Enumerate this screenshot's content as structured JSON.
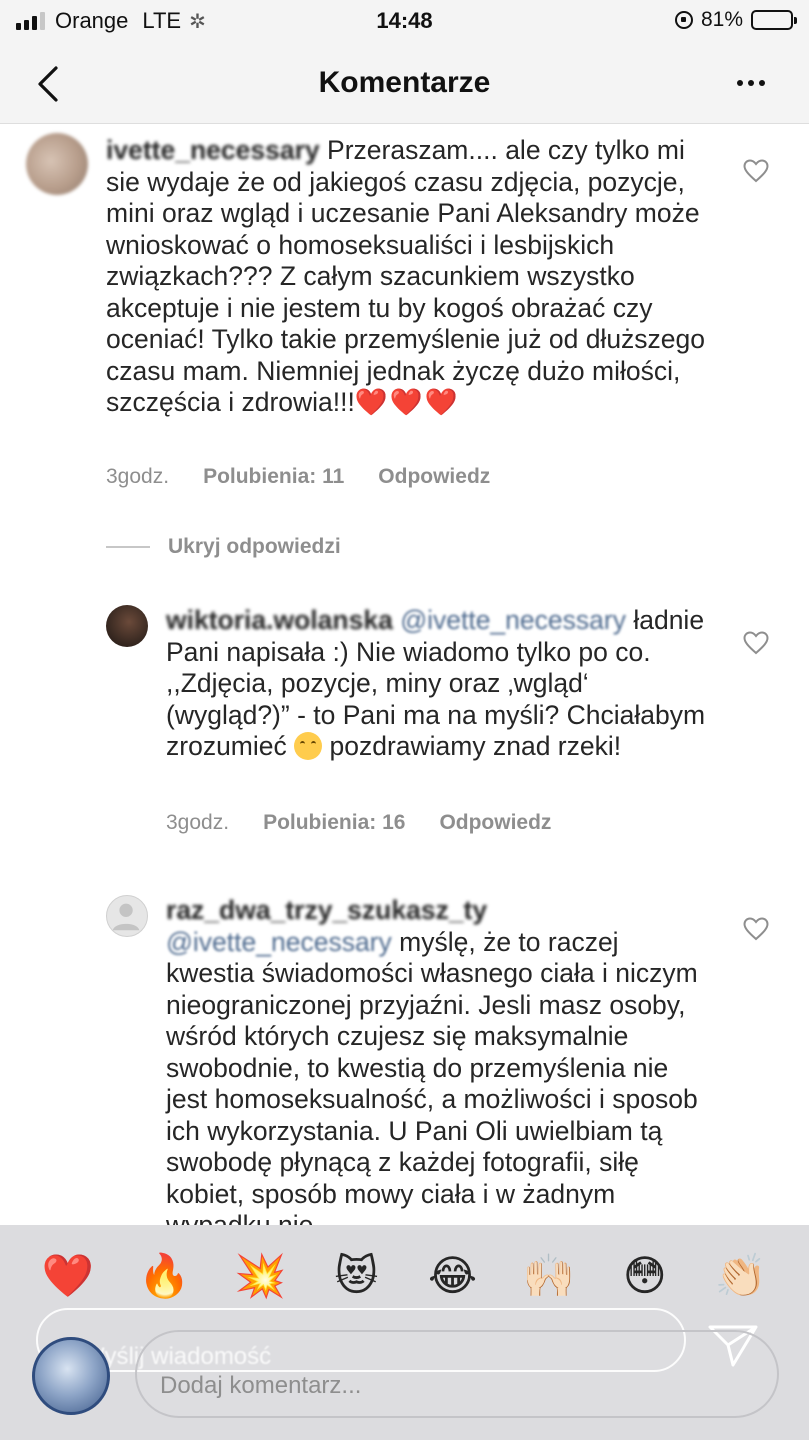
{
  "status_bar": {
    "carrier": "Orange",
    "network": "LTE",
    "time": "14:48",
    "battery": "81%",
    "battery_level": 0.81
  },
  "header": {
    "title": "Komentarze"
  },
  "comments": [
    {
      "username": "ivette_necessary",
      "text": "Przeraszam.... ale czy tylko mi sie wydaje że od jakiegoś czasu zdjęcia, pozycje, mini oraz wgląd i uczesanie Pani Aleksandry może wnioskować o homoseksualiści i lesbijskich związkach??? Z całym szacunkiem wszystko akceptuje i nie jestem tu by kogoś obrażać czy oceniać! Tylko takie przemyślenie już od dłuższego czasu mam. Niemniej jednak życzę dużo miłości, szczęścia i zdrowia!!!",
      "hearts": "❤️❤️❤️",
      "time": "3godz.",
      "likes": "Polubienia: 11",
      "reply": "Odpowiedz"
    }
  ],
  "hide_replies": "Ukryj odpowiedzi",
  "replies": [
    {
      "username": "wiktoria.wolanska",
      "mention": "@ivette_necessary",
      "text_before": "ładnie Pani napisała :) Nie wiadomo tylko po co. ,,Zdjęcia, pozycje, miny oraz ‚wgląd‘ (wygląd?)” - to Pani ma na myśli? Chciałabym zrozumieć ",
      "text_after": "pozdrawiamy znad rzeki!",
      "time": "3godz.",
      "likes": "Polubienia: 16",
      "reply": "Odpowiedz"
    },
    {
      "username": "raz_dwa_trzy_szukasz_ty",
      "mention": "@ivette_necessary",
      "text": "myślę, że to raczej kwestia świadomości własnego ciała i niczym nieograniczonej przyjaźni. Jesli masz osoby, wśród których czujesz się maksymalnie swobodnie, to kwestią do przemyślenia nie jest homoseksualność, a możliwości i sposob ich wykorzystania. U Pani Oli uwielbiam tą swobodę płynącą z każdej fotografii, siłę kobiet, sposób mowy ciała i w żadnym wypadku nie"
    }
  ],
  "reactions": [
    "❤️",
    "🔥",
    "💥",
    "😻",
    "😂",
    "🙌🏻",
    "😳",
    "👏🏻"
  ],
  "story_input": {
    "placeholder": "Wyślij wiadomość"
  },
  "comment_input": {
    "placeholder": "Dodaj komentarz..."
  },
  "colors": {
    "link": "#4f6b8f",
    "meta": "#8e8e8e",
    "text": "#262626",
    "bar_bg": "#f4f4f4"
  }
}
